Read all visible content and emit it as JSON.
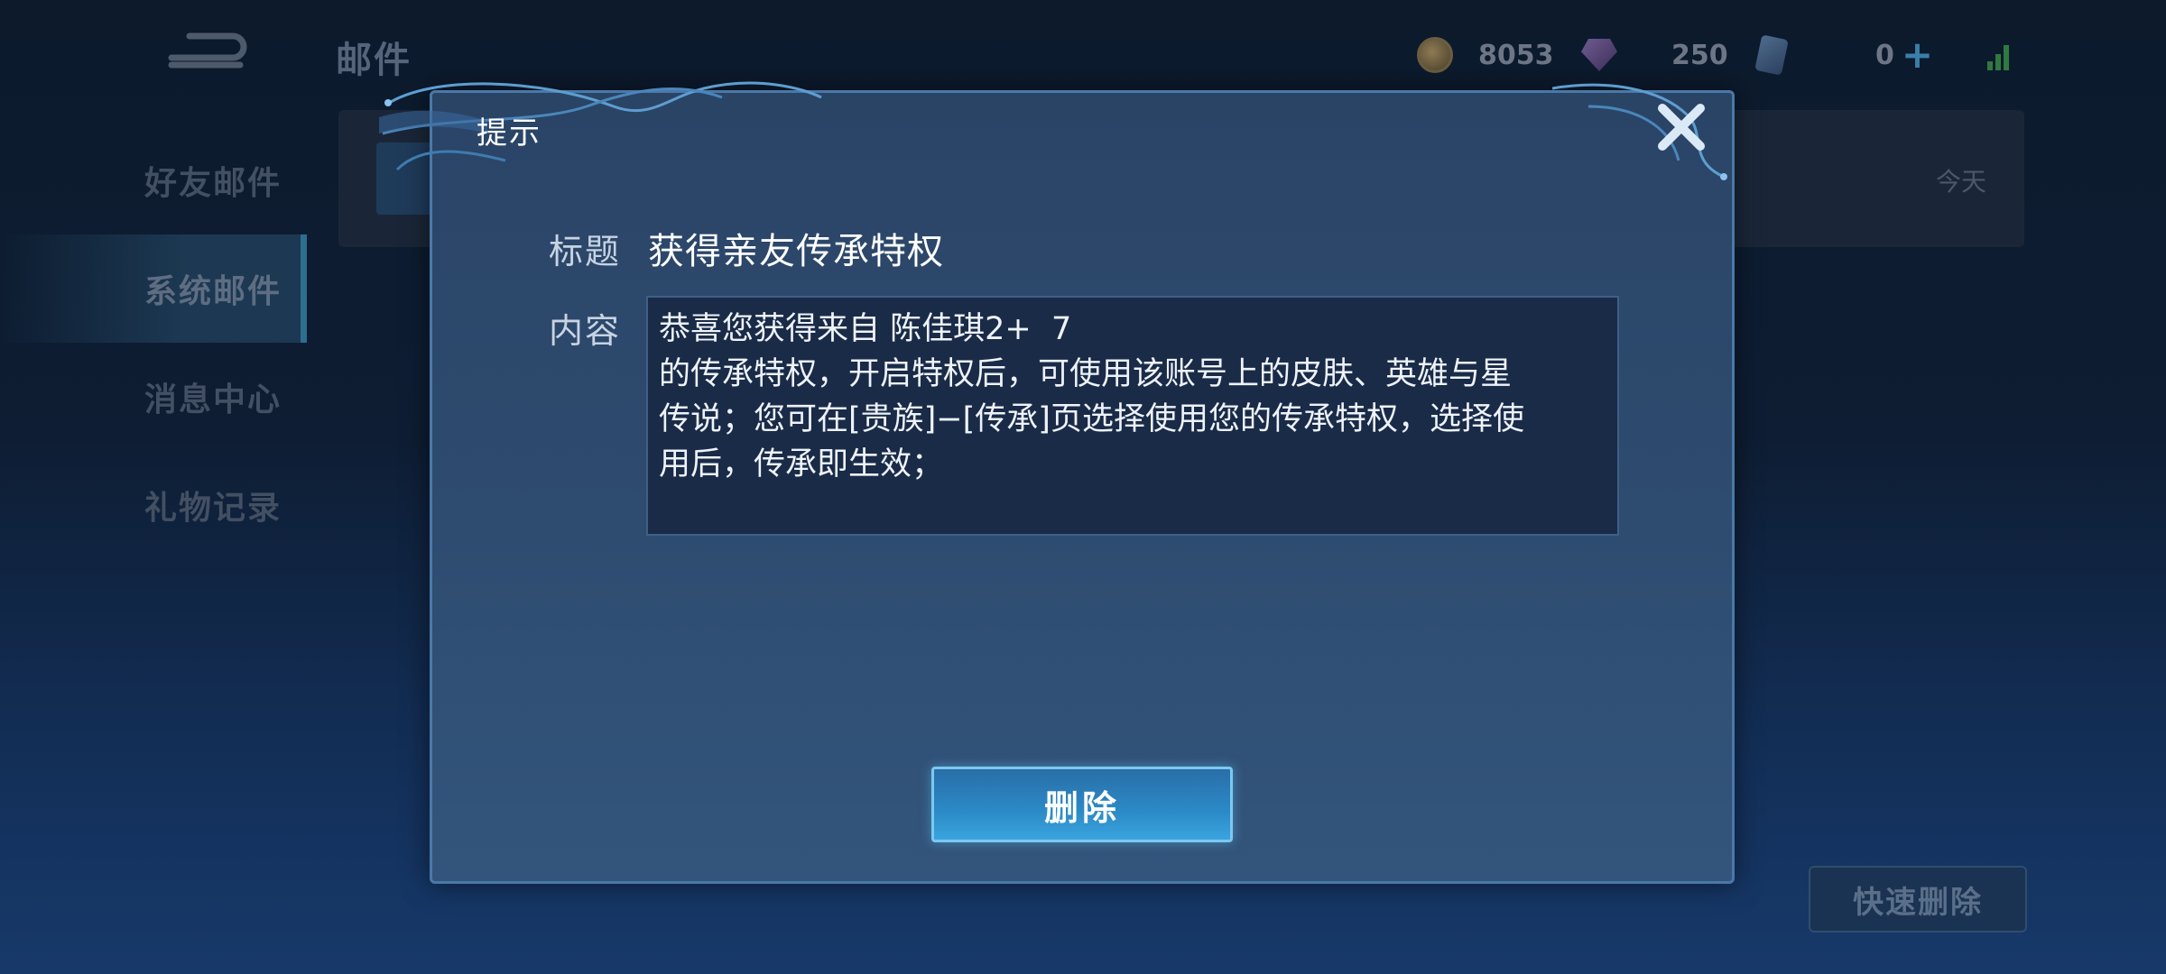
{
  "header": {
    "title": "邮件",
    "gold": "8053",
    "gems": "250",
    "cards": "0"
  },
  "sidebar": {
    "items": [
      {
        "label": "好友邮件"
      },
      {
        "label": "系统邮件",
        "active": true
      },
      {
        "label": "消息中心"
      },
      {
        "label": "礼物记录"
      }
    ]
  },
  "mail_list": {
    "rows": [
      {
        "date": "今天"
      }
    ]
  },
  "footer": {
    "quick_delete_label": "快速删除"
  },
  "dialog": {
    "title": "提示",
    "subject_label": "标题",
    "subject": "获得亲友传承特权",
    "content_label": "内容",
    "content_lines": [
      "恭喜您获得来自 陈佳琪2+  7",
      "的传承特权，开启特权后，可使用该账号上的皮肤、英雄与星",
      "传说；您可在[贵族]−[传承]页选择使用您的传承特权，选择使",
      "用后，传承即生效；"
    ],
    "delete_label": "删除"
  },
  "colors": {
    "dialog_bg": "#2e4c70",
    "button_accent": "#2b8ac6",
    "text_primary": "#ffffff"
  }
}
